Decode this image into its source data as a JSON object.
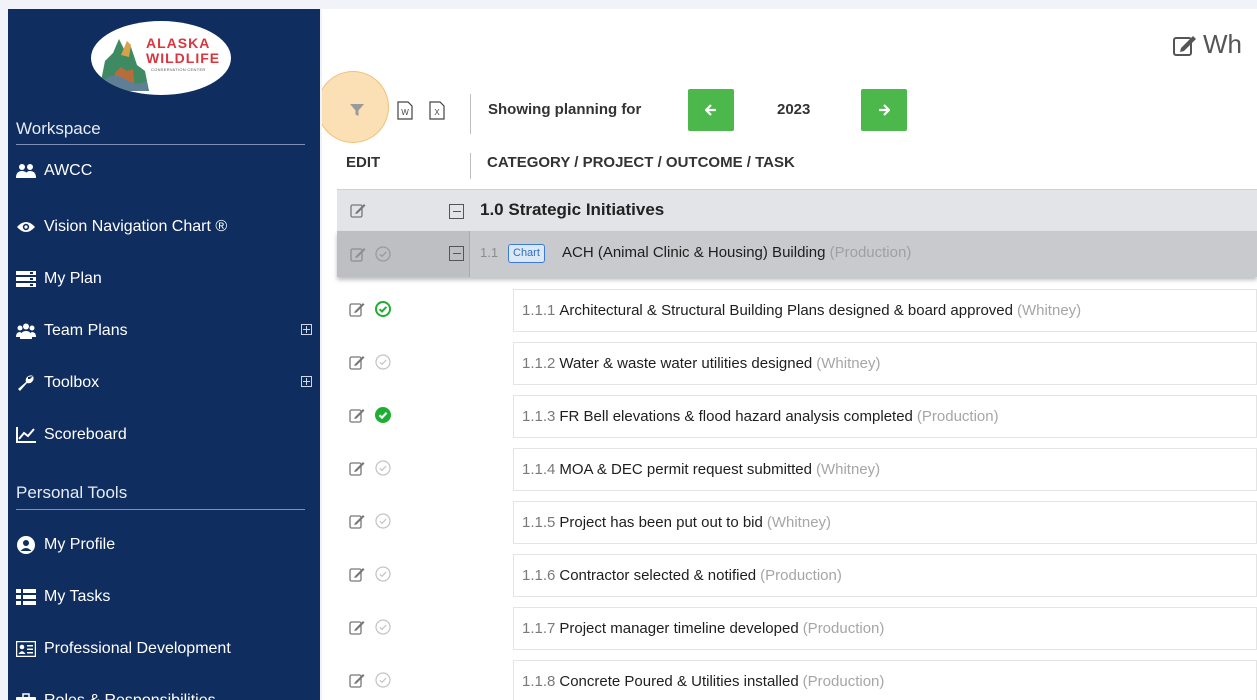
{
  "logo": {
    "title_line1": "ALASKA",
    "title_line2": "WILDLIFE",
    "subtitle": "CONSERVATION CENTER"
  },
  "sidebar": {
    "workspace_label": "Workspace",
    "workspace_items": [
      {
        "label": "AWCC",
        "icon": "users-icon"
      },
      {
        "label": "Vision Navigation Chart ®",
        "icon": "eye-icon"
      },
      {
        "label": "My Plan",
        "icon": "server-icon"
      },
      {
        "label": "Team Plans",
        "icon": "users-icon",
        "expandable": true
      },
      {
        "label": "Toolbox",
        "icon": "wrench-icon",
        "expandable": true
      },
      {
        "label": "Scoreboard",
        "icon": "line-chart-icon"
      }
    ],
    "personal_label": "Personal Tools",
    "personal_items": [
      {
        "label": "My Profile",
        "icon": "user-circle-icon"
      },
      {
        "label": "My Tasks",
        "icon": "list-icon"
      },
      {
        "label": "Professional Development",
        "icon": "id-card-icon"
      },
      {
        "label": "Roles & Responsibilities",
        "icon": "briefcase-icon"
      }
    ]
  },
  "main": {
    "page_title": "Wh",
    "toolbar": {
      "showing_label": "Showing planning for",
      "year": "2023"
    },
    "columns": {
      "edit": "EDIT",
      "category": "CATEGORY / PROJECT / OUTCOME / TASK"
    },
    "category": {
      "title": "1.0 Strategic Initiatives"
    },
    "project": {
      "number": "1.1",
      "tag": "Chart",
      "title": "ACH (Animal Clinic & Housing) Building",
      "owner": "(Production)"
    },
    "tasks": [
      {
        "number": "1.1.1",
        "title": "Architectural & Structural Building Plans designed & board approved",
        "owner": "(Whitney)",
        "status": "complete-outline"
      },
      {
        "number": "1.1.2",
        "title": "Water & waste water utilities designed",
        "owner": "(Whitney)",
        "status": "pending"
      },
      {
        "number": "1.1.3",
        "title": "FR Bell elevations & flood hazard analysis completed",
        "owner": "(Production)",
        "status": "complete-solid"
      },
      {
        "number": "1.1.4",
        "title": "MOA & DEC permit request submitted",
        "owner": "(Whitney)",
        "status": "pending"
      },
      {
        "number": "1.1.5",
        "title": "Project has been put out to bid",
        "owner": "(Whitney)",
        "status": "pending"
      },
      {
        "number": "1.1.6",
        "title": "Contractor selected & notified",
        "owner": "(Production)",
        "status": "pending"
      },
      {
        "number": "1.1.7",
        "title": "Project manager timeline developed",
        "owner": "(Production)",
        "status": "pending"
      },
      {
        "number": "1.1.8",
        "title": "Concrete Poured & Utilities installed",
        "owner": "(Production)",
        "status": "pending"
      }
    ]
  },
  "colors": {
    "sidebar": "#0f2d5f",
    "accent_green": "#4cb84c",
    "status_green": "#1fae32",
    "highlight": "#f7c478"
  }
}
